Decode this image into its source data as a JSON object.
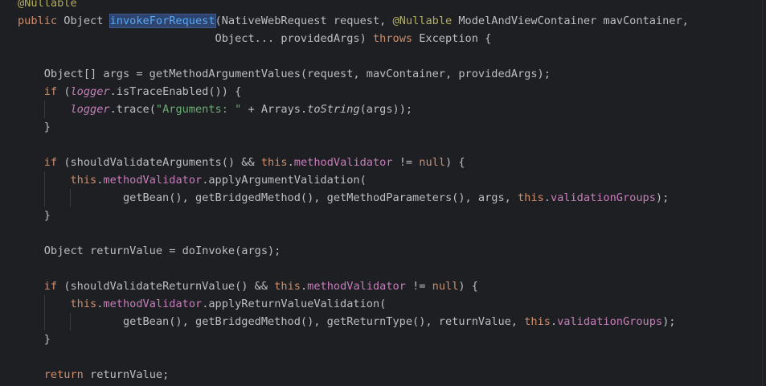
{
  "editor": {
    "lines": [
      [
        {
          "t": "@Nullable",
          "c": "ann"
        }
      ],
      [
        {
          "t": "public ",
          "c": "kw"
        },
        {
          "t": "Object "
        },
        {
          "t": "invokeForRequest",
          "c": "mdecl hl"
        },
        {
          "t": "(NativeWebRequest request, "
        },
        {
          "t": "@Nullable ",
          "c": "ann"
        },
        {
          "t": "ModelAndViewContainer mavContainer,"
        }
      ],
      [
        {
          "t": "                              Object... providedArgs) "
        },
        {
          "t": "throws ",
          "c": "kw"
        },
        {
          "t": "Exception {"
        }
      ],
      [],
      [
        {
          "t": "    Object[] args = getMethodArgumentValues(request, mavContainer, providedArgs);"
        }
      ],
      [
        {
          "t": "    "
        },
        {
          "t": "if ",
          "c": "kw"
        },
        {
          "t": "("
        },
        {
          "t": "logger",
          "c": "fld it"
        },
        {
          "t": ".isTraceEnabled()) {"
        }
      ],
      [
        {
          "t": "        "
        },
        {
          "t": "logger",
          "c": "fld it"
        },
        {
          "t": ".trace("
        },
        {
          "t": "\"Arguments: \"",
          "c": "str"
        },
        {
          "t": " + Arrays."
        },
        {
          "t": "toString",
          "c": "it"
        },
        {
          "t": "(args));"
        }
      ],
      [
        {
          "t": "    }"
        }
      ],
      [],
      [
        {
          "t": "    "
        },
        {
          "t": "if ",
          "c": "kw"
        },
        {
          "t": "(shouldValidateArguments() && "
        },
        {
          "t": "this",
          "c": "kw"
        },
        {
          "t": "."
        },
        {
          "t": "methodValidator",
          "c": "fld"
        },
        {
          "t": " != "
        },
        {
          "t": "null",
          "c": "kw"
        },
        {
          "t": ") {"
        }
      ],
      [
        {
          "t": "        "
        },
        {
          "t": "this",
          "c": "kw"
        },
        {
          "t": "."
        },
        {
          "t": "methodValidator",
          "c": "fld"
        },
        {
          "t": ".applyArgumentValidation("
        }
      ],
      [
        {
          "t": "                getBean(), getBridgedMethod(), getMethodParameters(), args, "
        },
        {
          "t": "this",
          "c": "kw"
        },
        {
          "t": "."
        },
        {
          "t": "validationGroups",
          "c": "fld"
        },
        {
          "t": ");"
        }
      ],
      [
        {
          "t": "    }"
        }
      ],
      [],
      [
        {
          "t": "    Object returnValue = doInvoke(args);"
        }
      ],
      [],
      [
        {
          "t": "    "
        },
        {
          "t": "if ",
          "c": "kw"
        },
        {
          "t": "(shouldValidateReturnValue() && "
        },
        {
          "t": "this",
          "c": "kw"
        },
        {
          "t": "."
        },
        {
          "t": "methodValidator",
          "c": "fld"
        },
        {
          "t": " != "
        },
        {
          "t": "null",
          "c": "kw"
        },
        {
          "t": ") {"
        }
      ],
      [
        {
          "t": "        "
        },
        {
          "t": "this",
          "c": "kw"
        },
        {
          "t": "."
        },
        {
          "t": "methodValidator",
          "c": "fld"
        },
        {
          "t": ".applyReturnValueValidation("
        }
      ],
      [
        {
          "t": "                getBean(), getBridgedMethod(), getReturnType(), returnValue, "
        },
        {
          "t": "this",
          "c": "kw"
        },
        {
          "t": "."
        },
        {
          "t": "validationGroups",
          "c": "fld"
        },
        {
          "t": ");"
        }
      ],
      [
        {
          "t": "    }"
        }
      ],
      [],
      [
        {
          "t": "    "
        },
        {
          "t": "return ",
          "c": "kw"
        },
        {
          "t": "returnValue;"
        }
      ]
    ],
    "indent_guides": [
      {
        "line": 6,
        "cols": [
          4
        ]
      },
      {
        "line": 10,
        "cols": [
          4
        ]
      },
      {
        "line": 11,
        "cols": [
          4,
          8
        ]
      },
      {
        "line": 17,
        "cols": [
          4
        ]
      },
      {
        "line": 18,
        "cols": [
          4,
          8
        ]
      }
    ],
    "colors": {
      "background": "#1e1f22",
      "default_text": "#bcbec4",
      "keyword": "#cf8e6d",
      "annotation": "#b3ae60",
      "field": "#c77dbb",
      "string": "#6aab73",
      "method_declaration": "#56a8f5",
      "identifier_highlight": "#2e436e"
    }
  }
}
